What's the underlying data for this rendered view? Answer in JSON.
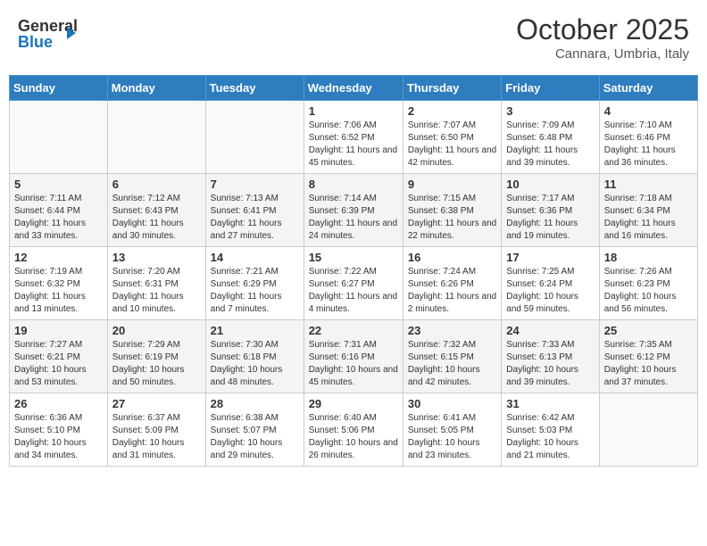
{
  "header": {
    "logo_line1": "General",
    "logo_line2": "Blue",
    "month": "October 2025",
    "location": "Cannara, Umbria, Italy"
  },
  "days_of_week": [
    "Sunday",
    "Monday",
    "Tuesday",
    "Wednesday",
    "Thursday",
    "Friday",
    "Saturday"
  ],
  "weeks": [
    [
      {
        "day": "",
        "info": ""
      },
      {
        "day": "",
        "info": ""
      },
      {
        "day": "",
        "info": ""
      },
      {
        "day": "1",
        "info": "Sunrise: 7:06 AM\nSunset: 6:52 PM\nDaylight: 11 hours and 45 minutes."
      },
      {
        "day": "2",
        "info": "Sunrise: 7:07 AM\nSunset: 6:50 PM\nDaylight: 11 hours and 42 minutes."
      },
      {
        "day": "3",
        "info": "Sunrise: 7:09 AM\nSunset: 6:48 PM\nDaylight: 11 hours and 39 minutes."
      },
      {
        "day": "4",
        "info": "Sunrise: 7:10 AM\nSunset: 6:46 PM\nDaylight: 11 hours and 36 minutes."
      }
    ],
    [
      {
        "day": "5",
        "info": "Sunrise: 7:11 AM\nSunset: 6:44 PM\nDaylight: 11 hours and 33 minutes."
      },
      {
        "day": "6",
        "info": "Sunrise: 7:12 AM\nSunset: 6:43 PM\nDaylight: 11 hours and 30 minutes."
      },
      {
        "day": "7",
        "info": "Sunrise: 7:13 AM\nSunset: 6:41 PM\nDaylight: 11 hours and 27 minutes."
      },
      {
        "day": "8",
        "info": "Sunrise: 7:14 AM\nSunset: 6:39 PM\nDaylight: 11 hours and 24 minutes."
      },
      {
        "day": "9",
        "info": "Sunrise: 7:15 AM\nSunset: 6:38 PM\nDaylight: 11 hours and 22 minutes."
      },
      {
        "day": "10",
        "info": "Sunrise: 7:17 AM\nSunset: 6:36 PM\nDaylight: 11 hours and 19 minutes."
      },
      {
        "day": "11",
        "info": "Sunrise: 7:18 AM\nSunset: 6:34 PM\nDaylight: 11 hours and 16 minutes."
      }
    ],
    [
      {
        "day": "12",
        "info": "Sunrise: 7:19 AM\nSunset: 6:32 PM\nDaylight: 11 hours and 13 minutes."
      },
      {
        "day": "13",
        "info": "Sunrise: 7:20 AM\nSunset: 6:31 PM\nDaylight: 11 hours and 10 minutes."
      },
      {
        "day": "14",
        "info": "Sunrise: 7:21 AM\nSunset: 6:29 PM\nDaylight: 11 hours and 7 minutes."
      },
      {
        "day": "15",
        "info": "Sunrise: 7:22 AM\nSunset: 6:27 PM\nDaylight: 11 hours and 4 minutes."
      },
      {
        "day": "16",
        "info": "Sunrise: 7:24 AM\nSunset: 6:26 PM\nDaylight: 11 hours and 2 minutes."
      },
      {
        "day": "17",
        "info": "Sunrise: 7:25 AM\nSunset: 6:24 PM\nDaylight: 10 hours and 59 minutes."
      },
      {
        "day": "18",
        "info": "Sunrise: 7:26 AM\nSunset: 6:23 PM\nDaylight: 10 hours and 56 minutes."
      }
    ],
    [
      {
        "day": "19",
        "info": "Sunrise: 7:27 AM\nSunset: 6:21 PM\nDaylight: 10 hours and 53 minutes."
      },
      {
        "day": "20",
        "info": "Sunrise: 7:29 AM\nSunset: 6:19 PM\nDaylight: 10 hours and 50 minutes."
      },
      {
        "day": "21",
        "info": "Sunrise: 7:30 AM\nSunset: 6:18 PM\nDaylight: 10 hours and 48 minutes."
      },
      {
        "day": "22",
        "info": "Sunrise: 7:31 AM\nSunset: 6:16 PM\nDaylight: 10 hours and 45 minutes."
      },
      {
        "day": "23",
        "info": "Sunrise: 7:32 AM\nSunset: 6:15 PM\nDaylight: 10 hours and 42 minutes."
      },
      {
        "day": "24",
        "info": "Sunrise: 7:33 AM\nSunset: 6:13 PM\nDaylight: 10 hours and 39 minutes."
      },
      {
        "day": "25",
        "info": "Sunrise: 7:35 AM\nSunset: 6:12 PM\nDaylight: 10 hours and 37 minutes."
      }
    ],
    [
      {
        "day": "26",
        "info": "Sunrise: 6:36 AM\nSunset: 5:10 PM\nDaylight: 10 hours and 34 minutes."
      },
      {
        "day": "27",
        "info": "Sunrise: 6:37 AM\nSunset: 5:09 PM\nDaylight: 10 hours and 31 minutes."
      },
      {
        "day": "28",
        "info": "Sunrise: 6:38 AM\nSunset: 5:07 PM\nDaylight: 10 hours and 29 minutes."
      },
      {
        "day": "29",
        "info": "Sunrise: 6:40 AM\nSunset: 5:06 PM\nDaylight: 10 hours and 26 minutes."
      },
      {
        "day": "30",
        "info": "Sunrise: 6:41 AM\nSunset: 5:05 PM\nDaylight: 10 hours and 23 minutes."
      },
      {
        "day": "31",
        "info": "Sunrise: 6:42 AM\nSunset: 5:03 PM\nDaylight: 10 hours and 21 minutes."
      },
      {
        "day": "",
        "info": ""
      }
    ]
  ]
}
